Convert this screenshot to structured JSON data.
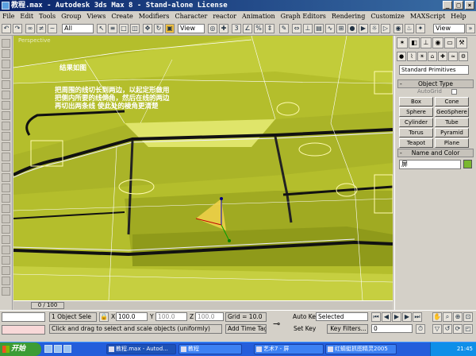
{
  "window": {
    "title": "教程.max - Autodesk 3ds Max 8 - Stand-alone License"
  },
  "menu": [
    "File",
    "Edit",
    "Tools",
    "Group",
    "Views",
    "Create",
    "Modifiers",
    "Character",
    "reactor",
    "Animation",
    "Graph Editors",
    "Rendering",
    "Customize",
    "MAXScript",
    "Help"
  ],
  "toolbar": {
    "selection_filter": "All",
    "ref_coord": "View",
    "ref_coord2": "View"
  },
  "viewport": {
    "label": "Perspective",
    "annotation_title": "结果如图",
    "annotation_body": [
      "把周围的线切长到两边，以起定形做用",
      "把侧内所要的线倒角，然后在线的两边",
      "再切出两条线  使此处的棱角更清楚"
    ]
  },
  "timeline": {
    "frame": "0 / 100"
  },
  "command_panel": {
    "category": "Standard Primitives",
    "object_type_header": "Object Type",
    "autogrid_label": "AutoGrid",
    "buttons": [
      "Box",
      "Cone",
      "Sphere",
      "GeoSphere",
      "Cylinder",
      "Tube",
      "Torus",
      "Pyramid",
      "Teapot",
      "Plane"
    ],
    "name_color_header": "Name and Color",
    "object_name": "屏",
    "object_color": "#7ab82e"
  },
  "status": {
    "selection": "1 Object Sele",
    "x_label": "X",
    "x": "100.0",
    "y_label": "Y",
    "y": "100.0",
    "z_label": "Z",
    "z": "100.0",
    "grid": "Grid = 10.0",
    "prompt": "Click and drag to select and scale objects (uniformly)",
    "add_time_tag": "Add Time Tag",
    "auto_key": "Auto Key",
    "set_key": "Set Key",
    "key_mode": "Selected",
    "key_filters": "Key Filters...",
    "frame_value": "0"
  },
  "taskbar": {
    "start": "开始",
    "tasks": [
      "教程.max - Autod...",
      "教程",
      "艺术7 - 屏",
      "红蜻蜓抓图精灵2005"
    ],
    "clock": "21:45"
  }
}
